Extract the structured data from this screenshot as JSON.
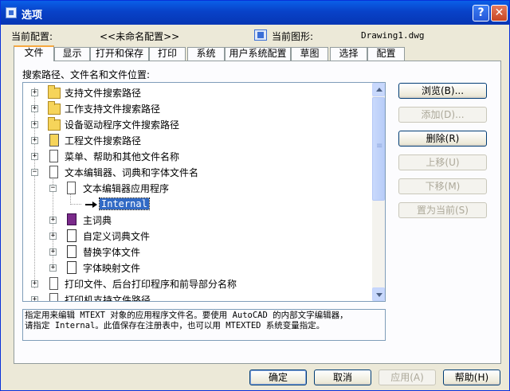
{
  "window": {
    "title": "选项",
    "help_glyph": "?",
    "close_glyph": "✕"
  },
  "header": {
    "profile_label": "当前配置:",
    "profile_value": "<<未命名配置>>",
    "drawing_label": "当前图形:",
    "drawing_value": "Drawing1.dwg"
  },
  "tabs": [
    {
      "label": "文件",
      "active": true
    },
    {
      "label": "显示"
    },
    {
      "label": "打开和保存"
    },
    {
      "label": "打印"
    },
    {
      "label": "系统"
    },
    {
      "label": "用户系统配置"
    },
    {
      "label": "草图"
    },
    {
      "label": "选择"
    },
    {
      "label": "配置"
    }
  ],
  "panel": {
    "list_label": "搜索路径、文件名和文件位置:"
  },
  "tree": {
    "items": [
      {
        "label": "支持文件搜索路径",
        "icon": "folder-search-icon"
      },
      {
        "label": "工作支持文件搜索路径",
        "icon": "folder-search-icon"
      },
      {
        "label": "设备驱动程序文件搜索路径",
        "icon": "folder-search-icon"
      },
      {
        "label": "工程文件搜索路径",
        "icon": "project-icon"
      },
      {
        "label": "菜单、帮助和其他文件名称",
        "icon": "document-icon"
      },
      {
        "label": "文本编辑器、词典和字体文件名",
        "icon": "document-icon"
      },
      {
        "label": "文本编辑器应用程序",
        "icon": "text-editor-icon"
      },
      {
        "label": "Internal",
        "icon": "arrow-right-icon"
      },
      {
        "label": "主词典",
        "icon": "book-icon"
      },
      {
        "label": "自定义词典文件",
        "icon": "dictionary-icon"
      },
      {
        "label": "替换字体文件",
        "icon": "font-file-icon"
      },
      {
        "label": "字体映射文件",
        "icon": "font-map-icon"
      },
      {
        "label": "打印文件、后台打印程序和前导部分名称",
        "icon": "document-icon"
      },
      {
        "label": "打印机支持文件路径",
        "icon": "document-icon"
      }
    ]
  },
  "description": {
    "line1": "指定用来编辑 MTEXT 对象的应用程序文件名。要使用 AutoCAD 的内部文字编辑器，",
    "line2": "请指定 Internal。此值保存在注册表中，也可以用 MTEXTED 系统变量指定。"
  },
  "side_buttons": {
    "browse": "浏览(B)...",
    "add": "添加(D)...",
    "remove": "删除(R)",
    "move_up": "上移(U)",
    "move_down": "下移(M)",
    "set_current": "置为当前(S)"
  },
  "footer_buttons": {
    "ok": "确定",
    "cancel": "取消",
    "apply": "应用(A)",
    "help": "帮助(H)"
  },
  "colors": {
    "titlebar": "#0842c8",
    "selection": "#316ac5",
    "active_tab_accent": "#f6a83f"
  }
}
